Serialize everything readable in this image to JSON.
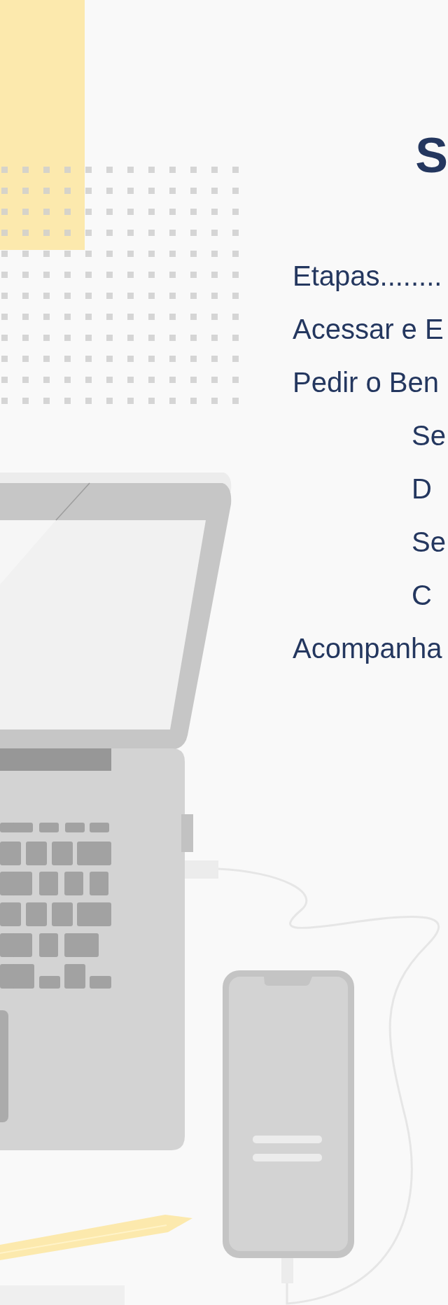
{
  "title": "S",
  "toc": [
    {
      "text": "Etapas........",
      "kind": "main"
    },
    {
      "text": "Acessar e E",
      "kind": "main"
    },
    {
      "text": "Pedir o Ben",
      "kind": "main"
    },
    {
      "text": "Se",
      "kind": "sub"
    },
    {
      "text": "D",
      "kind": "sub"
    },
    {
      "text": "Se",
      "kind": "sub"
    },
    {
      "text": "C",
      "kind": "sub"
    },
    {
      "text": "Acompanha",
      "kind": "main"
    }
  ]
}
